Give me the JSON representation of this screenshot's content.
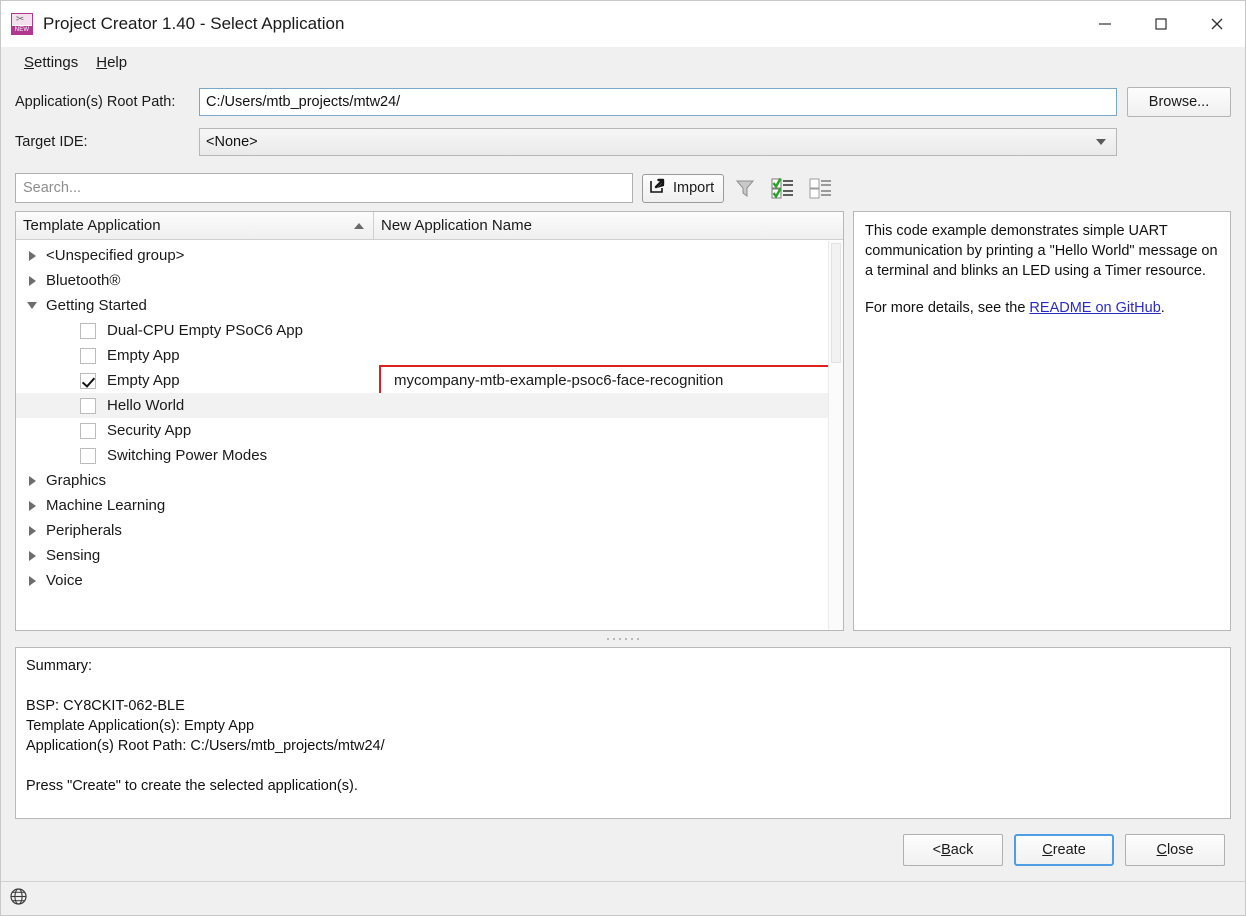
{
  "window": {
    "title": "Project Creator 1.40 - Select Application",
    "icon": "new-project-icon",
    "icon_badge": "NEW",
    "controls": {
      "minimize": "minimize-icon",
      "maximize": "maximize-icon",
      "close": "close-icon"
    }
  },
  "menubar": {
    "items": [
      {
        "label": "Settings",
        "mnemonic": "S",
        "rest": "ettings"
      },
      {
        "label": "Help",
        "mnemonic": "H",
        "rest": "elp"
      }
    ]
  },
  "form": {
    "root_path_label": "Application(s) Root Path:",
    "root_path_value": "C:/Users/mtb_projects/mtw24/",
    "browse_label": "Browse...",
    "target_ide_label": "Target IDE:",
    "target_ide_value": "<None>"
  },
  "toolbar": {
    "search_placeholder": "Search...",
    "search_value": "",
    "import_label": "Import",
    "filter_icon": "filter-funnel-icon",
    "check_all_icon": "check-all-icon",
    "uncheck_all_icon": "uncheck-all-icon"
  },
  "tree": {
    "columns": [
      {
        "label": "Template Application",
        "sorted": "asc"
      },
      {
        "label": "New Application Name"
      }
    ],
    "rows": [
      {
        "type": "group",
        "label": "<Unspecified group>",
        "expanded": false
      },
      {
        "type": "group",
        "label": "Bluetooth®",
        "expanded": false
      },
      {
        "type": "group",
        "label": "Getting Started",
        "expanded": true
      },
      {
        "type": "leaf",
        "label": "Dual-CPU Empty PSoC6 App",
        "checked": false,
        "highlighted": false
      },
      {
        "type": "leaf",
        "label": "Empty App",
        "checked": false,
        "highlighted": false
      },
      {
        "type": "leaf",
        "label": "Empty App",
        "checked": true,
        "highlighted": false
      },
      {
        "type": "leaf",
        "label": "Hello World",
        "checked": false,
        "highlighted": true
      },
      {
        "type": "leaf",
        "label": "Security App",
        "checked": false,
        "highlighted": false
      },
      {
        "type": "leaf",
        "label": "Switching Power Modes",
        "checked": false,
        "highlighted": false
      },
      {
        "type": "group",
        "label": "Graphics",
        "expanded": false
      },
      {
        "type": "group",
        "label": "Machine Learning",
        "expanded": false
      },
      {
        "type": "group",
        "label": "Peripherals",
        "expanded": false
      },
      {
        "type": "group",
        "label": "Sensing",
        "expanded": false
      },
      {
        "type": "group",
        "label": "Voice",
        "expanded": false
      }
    ],
    "new_app_name_value": "mycompany-mtb-example-psoc6-face-recognition",
    "new_app_name_highlight_color": "#e02020"
  },
  "description": {
    "paragraph1": "This code example demonstrates simple UART communication by printing a \"Hello World\" message on a terminal and blinks an LED using a Timer resource.",
    "paragraph2_prefix": "For more details, see the ",
    "link_label": "README on GitHub",
    "paragraph2_suffix": ".",
    "link_color": "#2a2ac8"
  },
  "summary": {
    "text": "Summary:\n\nBSP: CY8CKIT-062-BLE\nTemplate Application(s): Empty App\nApplication(s) Root Path: C:/Users/mtb_projects/mtw24/\n\nPress \"Create\" to create the selected application(s)."
  },
  "buttons": {
    "back": {
      "prefix": "< ",
      "mnemonic": "B",
      "rest": "ack"
    },
    "create": {
      "mnemonic": "C",
      "rest": "reate",
      "is_default": true
    },
    "close": {
      "mnemonic": "C",
      "rest": "lose"
    }
  },
  "statusbar": {
    "icon": "globe-icon"
  }
}
